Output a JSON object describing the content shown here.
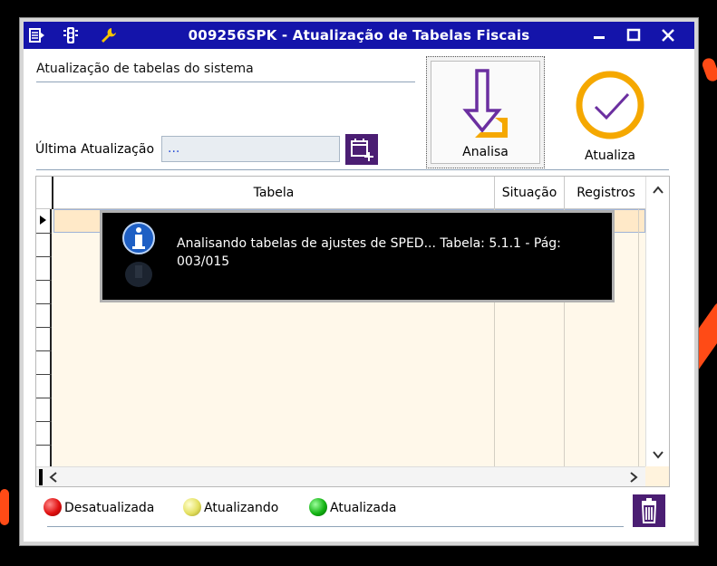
{
  "window": {
    "title": "009256SPK - Atualização de Tabelas Fiscais",
    "titlebar_color": "#1414aa"
  },
  "header": {
    "section_label": "Atualização de tabelas do sistema",
    "last_update_label": "Última Atualização",
    "last_update_value": "..."
  },
  "actions": {
    "analisa_label": "Analisa",
    "atualiza_label": "Atualiza"
  },
  "table": {
    "columns": [
      "Tabela",
      "Situação",
      "Registros"
    ]
  },
  "notification": {
    "message": "Analisando tabelas de ajustes de SPED... Tabela: 5.1.1 - Pág: 003/015"
  },
  "legend": {
    "items": [
      {
        "label": "Desatualizada",
        "color": "#e01010"
      },
      {
        "label": "Atualizando",
        "color": "#e4e060"
      },
      {
        "label": "Atualizada",
        "color": "#14b414"
      }
    ]
  },
  "icons": {
    "titlebar": [
      "menu-icon",
      "traffic-light-icon",
      "wrench-icon"
    ],
    "window_controls": [
      "minimize-icon",
      "maximize-icon",
      "close-icon"
    ]
  },
  "colors": {
    "accent_purple": "#4b1e73",
    "accent_orange": "#f5a800",
    "analisa_purple": "#6b2fa0"
  }
}
